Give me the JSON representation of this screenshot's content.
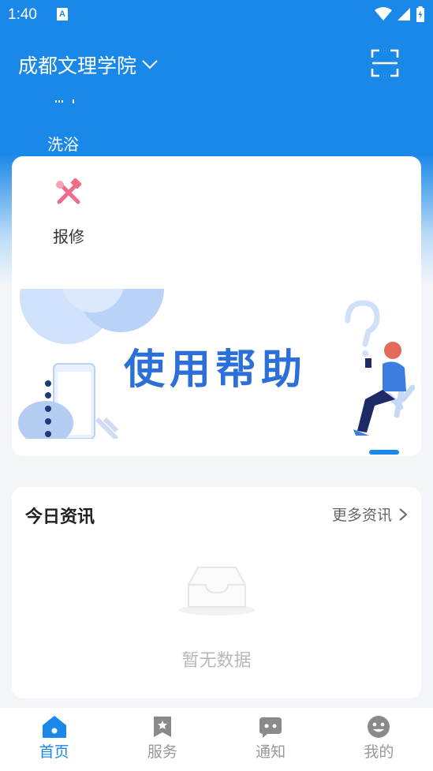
{
  "status_bar": {
    "time": "1:40",
    "notification_badge": "A"
  },
  "header": {
    "campus_name": "成都文理学院"
  },
  "partial_service": {
    "label": "洗浴"
  },
  "services": [
    {
      "label": "报修",
      "icon": "repair-tools-icon"
    }
  ],
  "banner": {
    "text": "使用帮助"
  },
  "news": {
    "title": "今日资讯",
    "more_label": "更多资讯",
    "empty_text": "暂无数据"
  },
  "tabbar": {
    "tabs": [
      {
        "label": "首页",
        "icon": "home-icon",
        "active": true
      },
      {
        "label": "服务",
        "icon": "service-icon",
        "active": false
      },
      {
        "label": "通知",
        "icon": "message-icon",
        "active": false
      },
      {
        "label": "我的",
        "icon": "smile-icon",
        "active": false
      }
    ]
  },
  "colors": {
    "primary": "#1a88e8",
    "background": "#f3f5f9",
    "banner_text": "#2c6fd8",
    "muted_text": "#b8b8b8"
  }
}
